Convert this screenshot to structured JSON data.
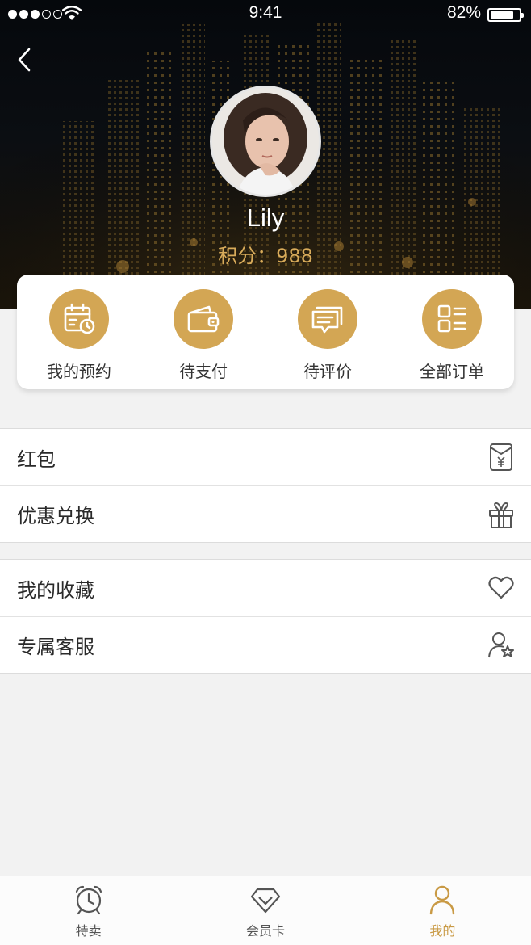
{
  "status_bar": {
    "time": "9:41",
    "battery_percent": "82%",
    "battery_level": 0.82,
    "signal_bars": 3,
    "signal_total": 5
  },
  "profile": {
    "name": "Lily",
    "points": "积分：988"
  },
  "orders": [
    {
      "label": "我的预约",
      "icon": "calendar-clock-icon"
    },
    {
      "label": "待支付",
      "icon": "wallet-icon"
    },
    {
      "label": "待评价",
      "icon": "comment-icon"
    },
    {
      "label": "全部订单",
      "icon": "list-icon"
    }
  ],
  "menu_group_1": [
    {
      "label": "红包",
      "icon": "red-packet-icon"
    },
    {
      "label": "优惠兑换",
      "icon": "gift-icon"
    }
  ],
  "menu_group_2": [
    {
      "label": "我的收藏",
      "icon": "heart-icon"
    },
    {
      "label": "专属客服",
      "icon": "user-star-icon"
    }
  ],
  "tabs": [
    {
      "label": "特卖",
      "icon": "alarm-clock-icon",
      "active": false
    },
    {
      "label": "会员卡",
      "icon": "diamond-icon",
      "active": false
    },
    {
      "label": "我的",
      "icon": "person-icon",
      "active": true
    }
  ],
  "colors": {
    "accent_gold": "#d3a654",
    "active_tab": "#c99a45",
    "points_text": "#d8ab5a"
  }
}
